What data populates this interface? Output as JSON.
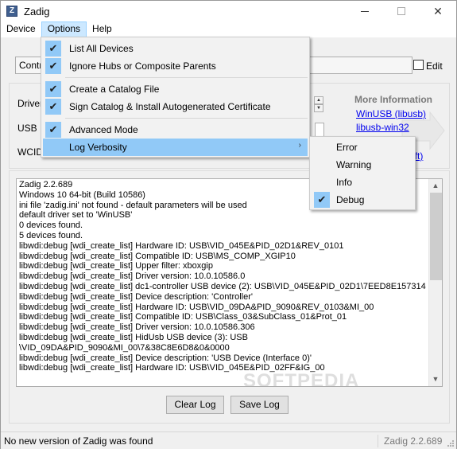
{
  "window": {
    "title": "Zadig",
    "icon_letter": "Z"
  },
  "menubar": {
    "items": [
      "Device",
      "Options",
      "Help"
    ]
  },
  "main": {
    "device_select_value": "Contr",
    "edit_label": "Edit",
    "driver_label": "Driver",
    "usbid_label": "USB ID",
    "wcid_label": "WCID"
  },
  "more_info": {
    "title": "More Information",
    "links": [
      "WinUSB (libusb)",
      "libusb-win32",
      "oft)"
    ]
  },
  "options_menu": {
    "items": [
      {
        "label": "List All Devices",
        "checked": true
      },
      {
        "label": "Ignore Hubs or Composite Parents",
        "checked": true
      },
      {
        "label": "Create a Catalog File",
        "checked": true
      },
      {
        "label": "Sign Catalog & Install Autogenerated Certificate",
        "checked": true
      },
      {
        "label": "Advanced Mode",
        "checked": true
      },
      {
        "label": "Log Verbosity",
        "checked": false
      }
    ]
  },
  "verbosity_menu": {
    "items": [
      {
        "label": "Error",
        "checked": false
      },
      {
        "label": "Warning",
        "checked": false
      },
      {
        "label": "Info",
        "checked": false
      },
      {
        "label": "Debug",
        "checked": true
      }
    ]
  },
  "log": {
    "lines": [
      "Zadig 2.2.689",
      "Windows 10 64-bit (Build 10586)",
      "ini file 'zadig.ini' not found - default parameters will be used",
      "default driver set to 'WinUSB'",
      "0 devices found.",
      "5 devices found.",
      "libwdi:debug [wdi_create_list] Hardware ID: USB\\VID_045E&PID_02D1&REV_0101",
      "libwdi:debug [wdi_create_list] Compatible ID: USB\\MS_COMP_XGIP10",
      "libwdi:debug [wdi_create_list] Upper filter: xboxgip",
      "libwdi:debug [wdi_create_list] Driver version: 10.0.10586.0",
      "libwdi:debug [wdi_create_list] dc1-controller USB device (2): USB\\VID_045E&PID_02D1\\7EED8E157314",
      "libwdi:debug [wdi_create_list] Device description: 'Controller'",
      "libwdi:debug [wdi_create_list] Hardware ID: USB\\VID_09DA&PID_9090&REV_0103&MI_00",
      "libwdi:debug [wdi_create_list] Compatible ID: USB\\Class_03&SubClass_01&Prot_01",
      "libwdi:debug [wdi_create_list] Driver version: 10.0.10586.306",
      "libwdi:debug [wdi_create_list] HidUsb USB device (3): USB",
      "\\VID_09DA&PID_9090&MI_00\\7&38C8E6D8&0&0000",
      "libwdi:debug [wdi_create_list] Device description: 'USB Device (Interface 0)'",
      "libwdi:debug [wdi_create_list] Hardware ID: USB\\VID_045E&PID_02FF&IG_00"
    ],
    "watermark": "SOFTPEDIA"
  },
  "buttons": {
    "clear_log": "Clear Log",
    "save_log": "Save Log"
  },
  "statusbar": {
    "message": "No new version of Zadig was found",
    "version": "Zadig 2.2.689"
  }
}
